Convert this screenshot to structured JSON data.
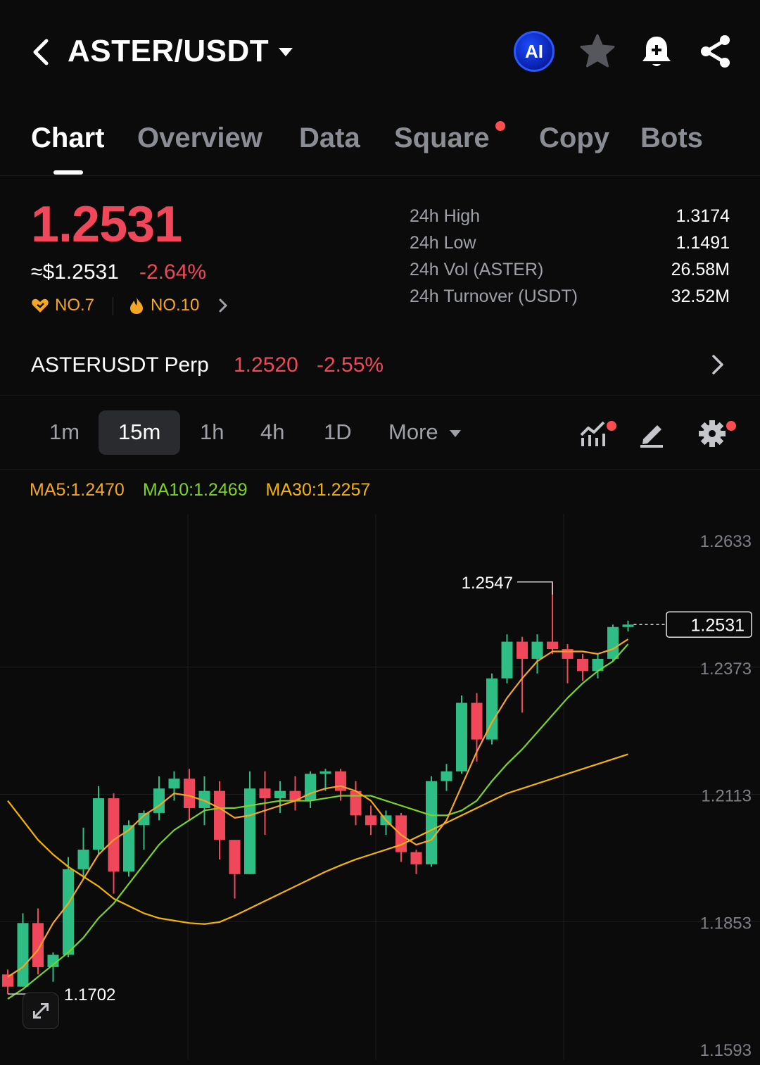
{
  "header": {
    "pair": "ASTER/USDT",
    "ai_label": "AI"
  },
  "tabs": [
    {
      "label": "Chart",
      "active": true
    },
    {
      "label": "Overview"
    },
    {
      "label": "Data"
    },
    {
      "label": "Square",
      "has_dot": true
    },
    {
      "label": "Copy"
    },
    {
      "label": "Bots"
    }
  ],
  "price": {
    "last": "1.2531",
    "usd": "≈$1.2531",
    "change_pct": "-2.64%",
    "rank1": "NO.7",
    "rank2": "NO.10"
  },
  "stats": [
    {
      "label": "24h High",
      "value": "1.3174"
    },
    {
      "label": "24h Low",
      "value": "1.1491"
    },
    {
      "label": "24h Vol (ASTER)",
      "value": "26.58M"
    },
    {
      "label": "24h Turnover (USDT)",
      "value": "32.52M"
    }
  ],
  "perp": {
    "name": "ASTERUSDT Perp",
    "price": "1.2520",
    "change_pct": "-2.55%"
  },
  "intervals": {
    "items": [
      "1m",
      "15m",
      "1h",
      "4h",
      "1D"
    ],
    "active": "15m",
    "more": "More"
  },
  "ma": {
    "ma5": "MA5:1.2470",
    "ma10": "MA10:1.2469",
    "ma30": "MA30:1.2257"
  },
  "colors": {
    "up": "#2ebd85",
    "down": "#f0475b",
    "ma5": "#f5a623",
    "ma10": "#7ed321",
    "ma30": "#f5b400"
  },
  "chart_data": {
    "type": "candlestick",
    "y_ticks": [
      "1.2633",
      "1.2373",
      "1.2113",
      "1.1853",
      "1.1593"
    ],
    "ylim": [
      1.1593,
      1.2633
    ],
    "current_price_label": "1.2531",
    "high_marker": "1.2547",
    "low_marker": "1.1702",
    "candles": [
      {
        "o": 1.1745,
        "h": 1.1755,
        "l": 1.1705,
        "c": 1.172
      },
      {
        "o": 1.172,
        "h": 1.187,
        "l": 1.172,
        "c": 1.185
      },
      {
        "o": 1.185,
        "h": 1.188,
        "l": 1.1745,
        "c": 1.176
      },
      {
        "o": 1.176,
        "h": 1.179,
        "l": 1.173,
        "c": 1.1785
      },
      {
        "o": 1.1785,
        "h": 1.1985,
        "l": 1.178,
        "c": 1.196
      },
      {
        "o": 1.196,
        "h": 1.2045,
        "l": 1.194,
        "c": 1.2
      },
      {
        "o": 1.2,
        "h": 1.213,
        "l": 1.199,
        "c": 1.2105
      },
      {
        "o": 1.2105,
        "h": 1.2115,
        "l": 1.191,
        "c": 1.1955
      },
      {
        "o": 1.1955,
        "h": 1.206,
        "l": 1.1945,
        "c": 1.205
      },
      {
        "o": 1.205,
        "h": 1.208,
        "l": 1.2,
        "c": 1.2075
      },
      {
        "o": 1.2075,
        "h": 1.215,
        "l": 1.206,
        "c": 1.2125
      },
      {
        "o": 1.2125,
        "h": 1.216,
        "l": 1.21,
        "c": 1.2145
      },
      {
        "o": 1.2145,
        "h": 1.2165,
        "l": 1.206,
        "c": 1.2085
      },
      {
        "o": 1.2085,
        "h": 1.215,
        "l": 1.205,
        "c": 1.212
      },
      {
        "o": 1.212,
        "h": 1.214,
        "l": 1.198,
        "c": 1.202
      },
      {
        "o": 1.202,
        "h": 1.202,
        "l": 1.19,
        "c": 1.195
      },
      {
        "o": 1.195,
        "h": 1.216,
        "l": 1.195,
        "c": 1.2125
      },
      {
        "o": 1.2125,
        "h": 1.216,
        "l": 1.203,
        "c": 1.2105
      },
      {
        "o": 1.2105,
        "h": 1.214,
        "l": 1.2075,
        "c": 1.212
      },
      {
        "o": 1.212,
        "h": 1.215,
        "l": 1.208,
        "c": 1.21
      },
      {
        "o": 1.21,
        "h": 1.216,
        "l": 1.2085,
        "c": 1.2155
      },
      {
        "o": 1.2155,
        "h": 1.2165,
        "l": 1.212,
        "c": 1.216
      },
      {
        "o": 1.216,
        "h": 1.2165,
        "l": 1.21,
        "c": 1.212
      },
      {
        "o": 1.212,
        "h": 1.214,
        "l": 1.205,
        "c": 1.207
      },
      {
        "o": 1.207,
        "h": 1.209,
        "l": 1.203,
        "c": 1.205
      },
      {
        "o": 1.205,
        "h": 1.208,
        "l": 1.203,
        "c": 1.207
      },
      {
        "o": 1.207,
        "h": 1.2075,
        "l": 1.1975,
        "c": 1.1995
      },
      {
        "o": 1.1995,
        "h": 1.2,
        "l": 1.195,
        "c": 1.197
      },
      {
        "o": 1.197,
        "h": 1.215,
        "l": 1.1965,
        "c": 1.214
      },
      {
        "o": 1.214,
        "h": 1.2175,
        "l": 1.212,
        "c": 1.216
      },
      {
        "o": 1.216,
        "h": 1.2315,
        "l": 1.2155,
        "c": 1.23
      },
      {
        "o": 1.23,
        "h": 1.232,
        "l": 1.218,
        "c": 1.2225
      },
      {
        "o": 1.2225,
        "h": 1.236,
        "l": 1.2215,
        "c": 1.235
      },
      {
        "o": 1.235,
        "h": 1.244,
        "l": 1.234,
        "c": 1.2425
      },
      {
        "o": 1.2425,
        "h": 1.2435,
        "l": 1.228,
        "c": 1.239
      },
      {
        "o": 1.239,
        "h": 1.244,
        "l": 1.236,
        "c": 1.2425
      },
      {
        "o": 1.2425,
        "h": 1.2547,
        "l": 1.24,
        "c": 1.241
      },
      {
        "o": 1.241,
        "h": 1.242,
        "l": 1.234,
        "c": 1.239
      },
      {
        "o": 1.239,
        "h": 1.24,
        "l": 1.2345,
        "c": 1.2365
      },
      {
        "o": 1.2365,
        "h": 1.24,
        "l": 1.235,
        "c": 1.239
      },
      {
        "o": 1.239,
        "h": 1.246,
        "l": 1.2385,
        "c": 1.2455
      },
      {
        "o": 1.2455,
        "h": 1.2468,
        "l": 1.2446,
        "c": 1.246
      }
    ],
    "ma5": [
      1.174,
      1.176,
      1.1795,
      1.185,
      1.189,
      1.194,
      1.199,
      1.202,
      1.204,
      1.207,
      1.209,
      1.2115,
      1.211,
      1.21,
      1.2085,
      1.2065,
      1.207,
      1.208,
      1.209,
      1.21,
      1.2115,
      1.2125,
      1.213,
      1.212,
      1.21,
      1.206,
      1.203,
      1.201,
      1.202,
      1.206,
      1.213,
      1.22,
      1.226,
      1.231,
      1.235,
      1.2385,
      1.2405,
      1.2405,
      1.2405,
      1.24,
      1.241,
      1.243
    ],
    "ma10": [
      1.1695,
      1.1715,
      1.174,
      1.1765,
      1.179,
      1.182,
      1.186,
      1.189,
      1.193,
      1.197,
      1.201,
      1.204,
      1.206,
      1.208,
      1.2085,
      1.2085,
      1.209,
      1.2095,
      1.21,
      1.21,
      1.21,
      1.2105,
      1.211,
      1.211,
      1.211,
      1.21,
      1.209,
      1.208,
      1.207,
      1.207,
      1.208,
      1.21,
      1.214,
      1.2175,
      1.2205,
      1.224,
      1.2275,
      1.231,
      1.234,
      1.2365,
      1.2385,
      1.242
    ],
    "ma30": [
      1.21,
      1.206,
      1.202,
      1.199,
      1.1965,
      1.1945,
      1.1925,
      1.19,
      1.1885,
      1.187,
      1.186,
      1.1855,
      1.185,
      1.1848,
      1.1852,
      1.1865,
      1.188,
      1.1895,
      1.191,
      1.1925,
      1.194,
      1.1955,
      1.1968,
      1.198,
      1.199,
      1.2,
      1.201,
      1.2025,
      1.204,
      1.2055,
      1.207,
      1.2085,
      1.21,
      1.2115,
      1.2125,
      1.2135,
      1.2145,
      1.2155,
      1.2165,
      1.2175,
      1.2185,
      1.2195
    ]
  }
}
